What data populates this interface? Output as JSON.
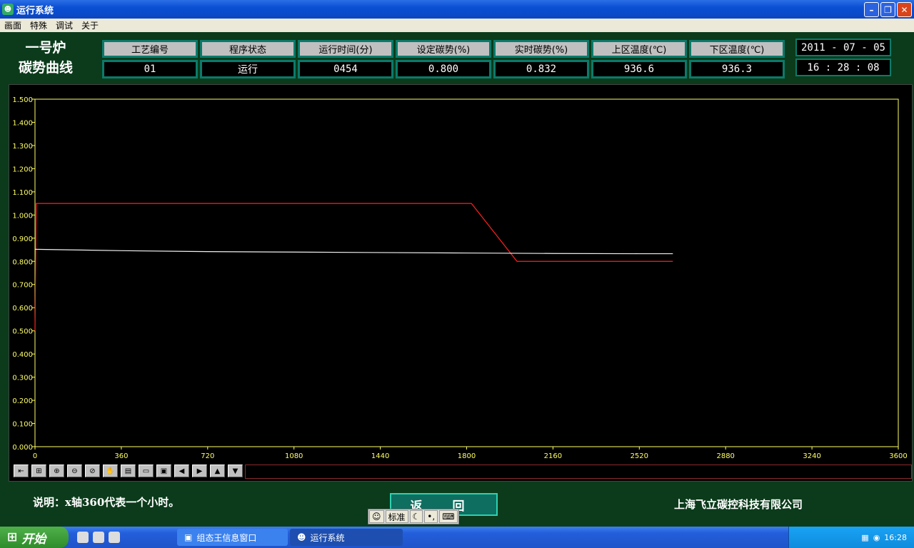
{
  "window": {
    "title": "运行系统"
  },
  "menu": [
    "画面",
    "特殊",
    "调试",
    "关于"
  ],
  "header": {
    "furnace_line1": "一号炉",
    "furnace_line2": "碳势曲线",
    "params": [
      {
        "label": "工艺编号",
        "value": "01"
      },
      {
        "label": "程序状态",
        "value": "运行"
      },
      {
        "label": "运行时间(分)",
        "value": "0454"
      },
      {
        "label": "设定碳势(%)",
        "value": "0.800"
      },
      {
        "label": "实时碳势(%)",
        "value": "0.832"
      },
      {
        "label": "上区温度(℃)",
        "value": "936.6"
      },
      {
        "label": "下区温度(℃)",
        "value": "936.3"
      }
    ],
    "date": "2011 - 07 - 05",
    "time": "16 : 28 : 08"
  },
  "chart_data": {
    "type": "line",
    "xlim": [
      0,
      3600
    ],
    "ylim": [
      0.0,
      1.5
    ],
    "xticks": [
      0,
      360,
      720,
      1080,
      1440,
      1800,
      2160,
      2520,
      2880,
      3240,
      3600
    ],
    "yticks": [
      "0.000",
      "0.100",
      "0.200",
      "0.300",
      "0.400",
      "0.500",
      "0.600",
      "0.700",
      "0.800",
      "0.900",
      "1.000",
      "1.100",
      "1.200",
      "1.300",
      "1.400",
      "1.500"
    ],
    "series": [
      {
        "color": "#ff2020",
        "points": [
          [
            0,
            0.5
          ],
          [
            5,
            1.05
          ],
          [
            1820,
            1.05
          ],
          [
            2010,
            0.8
          ],
          [
            2660,
            0.8
          ]
        ]
      },
      {
        "color": "#f0f0f0",
        "points": [
          [
            0,
            0.852
          ],
          [
            360,
            0.846
          ],
          [
            720,
            0.842
          ],
          [
            1080,
            0.84
          ],
          [
            1440,
            0.838
          ],
          [
            1800,
            0.836
          ],
          [
            2160,
            0.834
          ],
          [
            2520,
            0.833
          ],
          [
            2660,
            0.833
          ]
        ]
      }
    ]
  },
  "colors": {
    "set_carbon": "#ff2020",
    "real_carbon": "#f0f0f0",
    "axis": "#ffff66"
  },
  "toolbar_icons": [
    "fit-icon",
    "grid-icon",
    "zoom-in-icon",
    "zoom-out-icon",
    "zoom-reset-icon",
    "hand-icon",
    "select-icon",
    "open-icon",
    "save-icon",
    "left-icon",
    "right-icon",
    "up-icon",
    "down-icon"
  ],
  "footer": {
    "note": "说明：x轴360代表一个小时。",
    "back_button": "返 回",
    "company": "上海飞立碳控科技有限公司"
  },
  "ime": {
    "mode": "标准"
  },
  "taskbar": {
    "start": "开始",
    "items": [
      "组态王信息窗口",
      "运行系统"
    ],
    "clock": "16:28"
  }
}
